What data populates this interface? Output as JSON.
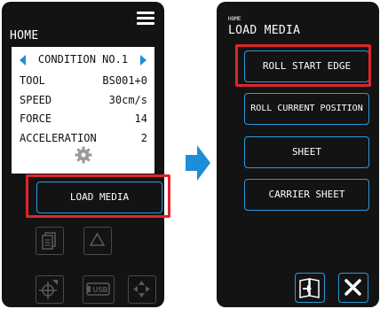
{
  "home": {
    "title": "HOME",
    "condition": "CONDITION NO.1",
    "params": [
      {
        "label": "TOOL",
        "value": "BS001+0"
      },
      {
        "label": "SPEED",
        "value": "30cm/s"
      },
      {
        "label": "FORCE",
        "value": "14"
      },
      {
        "label": "ACCELERATION",
        "value": "2"
      }
    ],
    "load_media_label": "LOAD MEDIA",
    "usb_label": "USB"
  },
  "load_media": {
    "header_small": "HOME",
    "title": "LOAD MEDIA",
    "buttons": [
      "ROLL START EDGE",
      "ROLL CURRENT POSITION",
      "SHEET",
      "CARRIER SHEET"
    ]
  },
  "colors": {
    "accent": "#2a9ae0",
    "highlight": "#e0242b",
    "arrow": "#1d8fd8",
    "screen_bg": "#131313"
  },
  "icons": [
    "menu-icon",
    "gear-icon",
    "copy-icon",
    "triangle-icon",
    "crosshair-icon",
    "usb-icon",
    "move-arrows-icon",
    "manual-book-icon",
    "close-icon",
    "transition-arrow-icon"
  ]
}
